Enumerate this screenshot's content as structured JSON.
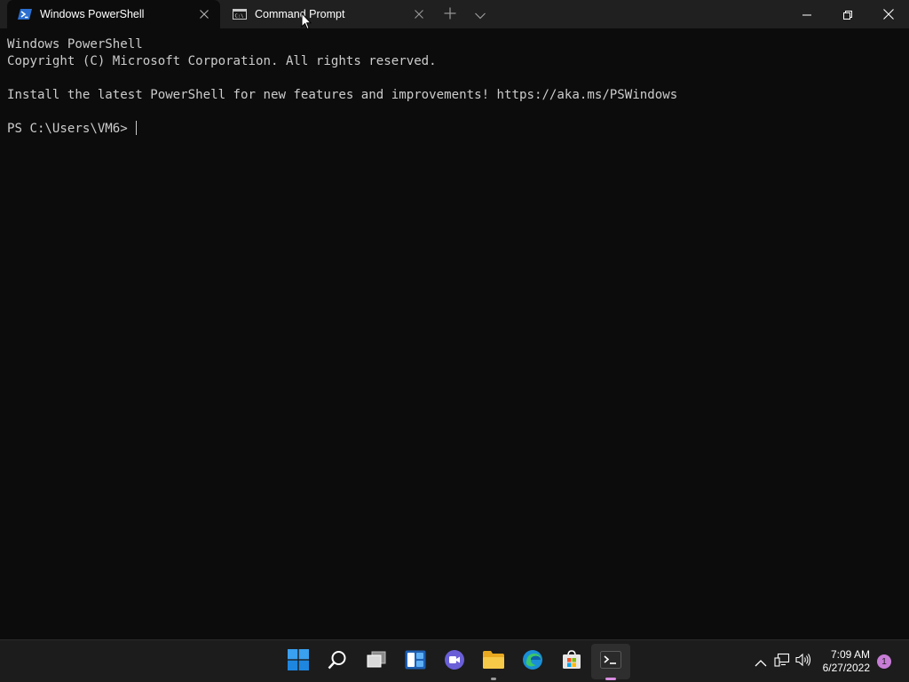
{
  "tabs": [
    {
      "title": "Windows PowerShell",
      "icon": "powershell-icon",
      "active": true
    },
    {
      "title": "Command Prompt",
      "icon": "cmd-icon",
      "active": false
    }
  ],
  "terminal": {
    "lines": [
      "Windows PowerShell",
      "Copyright (C) Microsoft Corporation. All rights reserved.",
      "",
      "Install the latest PowerShell for new features and improvements! https://aka.ms/PSWindows",
      "",
      "PS C:\\Users\\VM6> "
    ]
  },
  "taskbar": {
    "apps": [
      "start-icon",
      "search-icon",
      "task-view-icon",
      "widgets-icon",
      "chat-icon",
      "file-explorer-icon",
      "edge-icon",
      "store-icon",
      "terminal-icon"
    ],
    "time": "7:09 AM",
    "date": "6/27/2022",
    "notification_count": "1"
  },
  "colors": {
    "terminal_bg": "#0c0c0c",
    "terminal_fg": "#cccccc",
    "tabbar_bg": "#202020",
    "taskbar_bg": "#1c1c1c",
    "accent": "#d78ce0"
  }
}
